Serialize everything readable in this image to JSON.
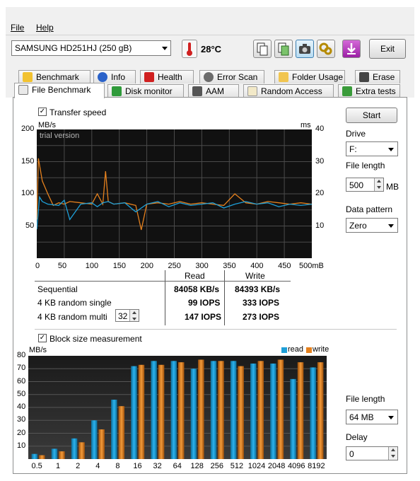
{
  "menu": {
    "file": "File",
    "help": "Help"
  },
  "toolbar": {
    "drive": "SAMSUNG HD251HJ (250 gB)",
    "temperature": "28°C",
    "exit": "Exit",
    "icons": [
      "copy-icon",
      "save-icon",
      "camera-icon",
      "options-icon",
      "download-icon"
    ]
  },
  "tabs_top": [
    "Benchmark",
    "Info",
    "Health",
    "Error Scan",
    "Folder Usage",
    "Erase"
  ],
  "tabs_bottom": [
    "File Benchmark",
    "Disk monitor",
    "AAM",
    "Random Access",
    "Extra tests"
  ],
  "transfer": {
    "checkbox_label": "Transfer speed",
    "checked": true,
    "unit_left": "MB/s",
    "unit_right": "ms",
    "watermark": "trial version",
    "left_ticks": [
      "200",
      "150",
      "100",
      "50"
    ],
    "right_ticks": [
      "40",
      "30",
      "20",
      "10"
    ],
    "x_ticks": [
      "0",
      "50",
      "100",
      "150",
      "200",
      "250",
      "300",
      "350",
      "400",
      "450",
      "500mB"
    ],
    "colors": {
      "read": "#1e9fd8",
      "write": "#e5811e",
      "bg": "#2b2b2b"
    }
  },
  "results": {
    "header_read": "Read",
    "header_write": "Write",
    "rows": [
      {
        "label": "Sequential",
        "read": "84058 KB/s",
        "write": "84393 KB/s"
      },
      {
        "label": "4 KB random single",
        "read": "99 IOPS",
        "write": "333 IOPS"
      },
      {
        "label": "4 KB random multi",
        "read": "147 IOPS",
        "write": "273 IOPS"
      }
    ],
    "queue_depth": "32"
  },
  "side": {
    "start": "Start",
    "drive_label": "Drive",
    "drive_value": "F:",
    "file_length_label": "File length",
    "file_length_value": "500",
    "file_length_unit": "MB",
    "pattern_label": "Data pattern",
    "pattern_value": "Zero",
    "bs_file_length_label": "File length",
    "bs_file_length_value": "64 MB",
    "delay_label": "Delay",
    "delay_value": "0"
  },
  "block": {
    "checkbox_label": "Block size measurement",
    "checked": true,
    "unit": "MB/s",
    "legend_read": "read",
    "legend_write": "write"
  },
  "chart_data": [
    {
      "type": "line",
      "title": "",
      "xlabel": "mB",
      "ylabel": "MB/s",
      "xlim": [
        0,
        500
      ],
      "ylim": [
        0,
        200
      ],
      "y2label": "ms",
      "y2lim": [
        0,
        40
      ],
      "series": [
        {
          "name": "read",
          "x": [
            0,
            5,
            10,
            20,
            40,
            50,
            60,
            80,
            100,
            110,
            120,
            130,
            140,
            160,
            180,
            200,
            220,
            240,
            260,
            280,
            300,
            320,
            340,
            360,
            380,
            400,
            420,
            440,
            460,
            480,
            500
          ],
          "values": [
            45,
            95,
            88,
            84,
            82,
            90,
            60,
            84,
            86,
            80,
            86,
            88,
            84,
            86,
            72,
            84,
            88,
            80,
            86,
            82,
            84,
            86,
            78,
            84,
            88,
            84,
            86,
            80,
            84,
            82,
            84
          ]
        },
        {
          "name": "write",
          "x": [
            0,
            3,
            6,
            10,
            15,
            20,
            30,
            40,
            50,
            60,
            80,
            100,
            110,
            120,
            125,
            130,
            140,
            160,
            180,
            190,
            200,
            220,
            240,
            260,
            280,
            300,
            320,
            340,
            360,
            380,
            400,
            420,
            440,
            460,
            480,
            500
          ],
          "values": [
            60,
            155,
            140,
            120,
            110,
            100,
            82,
            86,
            84,
            88,
            86,
            84,
            100,
            84,
            135,
            88,
            84,
            86,
            82,
            44,
            84,
            86,
            84,
            88,
            84,
            86,
            84,
            82,
            100,
            86,
            84,
            88,
            86,
            84,
            86,
            84
          ]
        }
      ]
    },
    {
      "type": "bar",
      "title": "",
      "ylabel": "MB/s",
      "ylim": [
        0,
        80
      ],
      "categories": [
        "0.5",
        "1",
        "2",
        "4",
        "8",
        "16",
        "32",
        "64",
        "128",
        "256",
        "512",
        "1024",
        "2048",
        "4096",
        "8192"
      ],
      "series": [
        {
          "name": "read",
          "values": [
            4,
            8,
            16,
            30,
            46,
            72,
            76,
            76,
            70,
            76,
            76,
            74,
            74,
            62,
            71
          ]
        },
        {
          "name": "write",
          "values": [
            3,
            6,
            13,
            23,
            41,
            73,
            73,
            75,
            77,
            76,
            72,
            76,
            77,
            75,
            75
          ]
        }
      ]
    }
  ]
}
